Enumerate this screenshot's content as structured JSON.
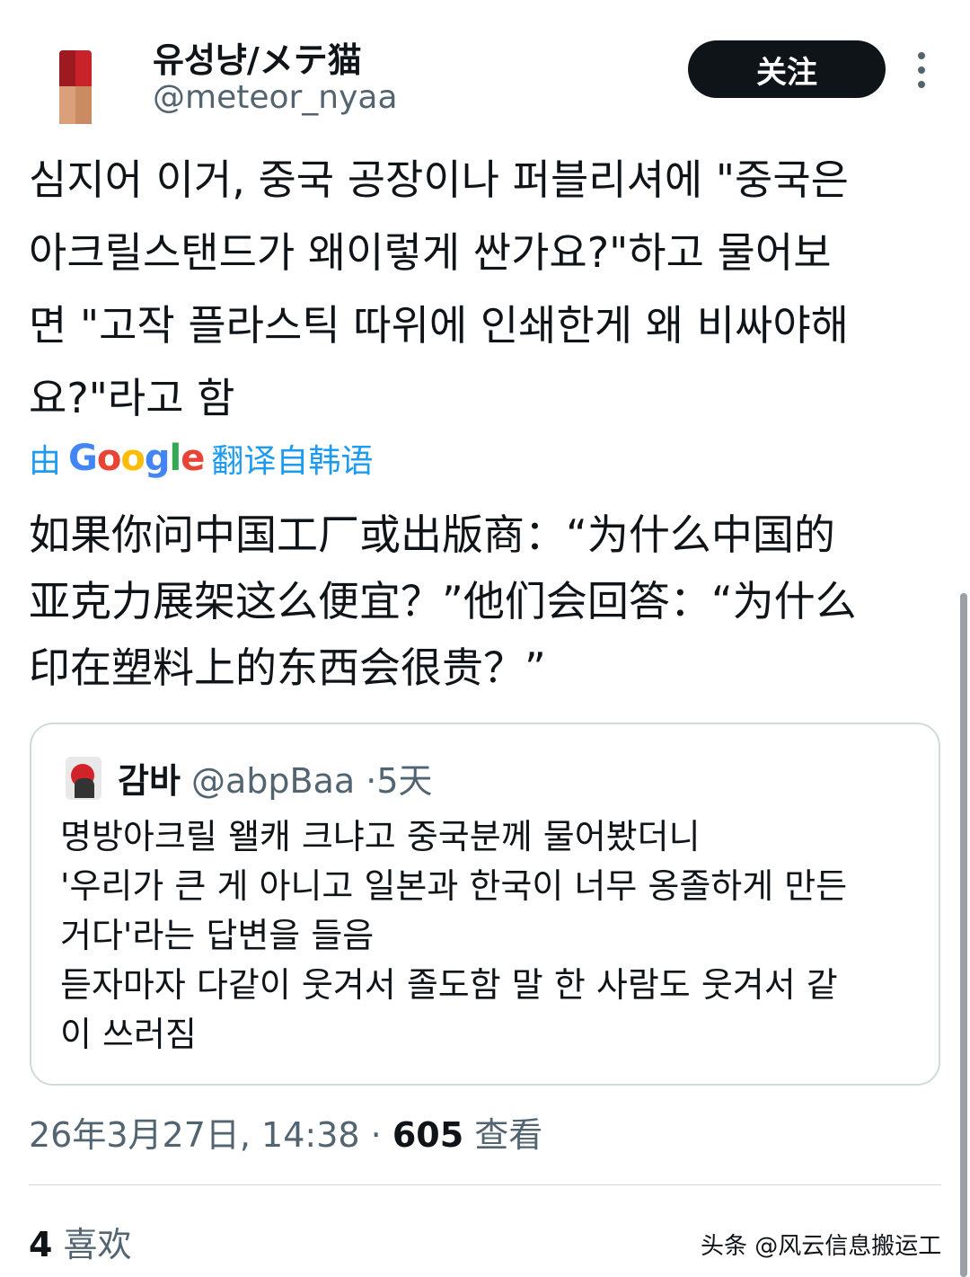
{
  "tweet": {
    "author_name": "유성냥/メテ猫",
    "author_handle": "@meteor_nyaa",
    "follow_label": "关注",
    "body_original": "심지어 이거, 중국 공장이나 퍼블리셔에 \"중국은\n아크릴스탠드가 왜이렇게 싼가요?\"하고 물어보\n면 \"고작 플라스틱 따위에 인쇄한게 왜 비싸야해\n요?\"라고 함",
    "translation_by": "由",
    "translation_brand": "Google",
    "translation_tail": "翻译自韩语",
    "body_translated": "如果你问中国工厂或出版商：“为什么中国的\n亚克力展架这么便宜？”他们会回答：“为什么\n印在塑料上的东西会很贵？”",
    "quoted": {
      "name": "감바",
      "handle": "@abpBaa",
      "separator": "·",
      "time": "5天",
      "text": "명방아크릴 왤캐 크냐고 중국분께 물어봤더니\n'우리가 큰 게 아니고 일본과 한국이 너무 옹졸하게 만든\n거다'라는 답변을 들음\n듣자마자 다같이 웃겨서 졸도함 말 한 사람도 웃겨서 같\n이 쓰러짐"
    },
    "timestamp": "26年3月27日, 14:38",
    "meta_separator": "·",
    "views_count": "605",
    "views_label": "查看",
    "likes_count": "4",
    "likes_label": "喜欢"
  },
  "watermark": "头条 @风云信息搬运工",
  "icons": {
    "more": "more-vertical-icon",
    "avatar": "avatar-image",
    "quoted_avatar": "avatar-image"
  },
  "colors": {
    "text_primary": "#0f1419",
    "text_secondary": "#536471",
    "link": "#1d9bf0",
    "border": "#cfd9de",
    "button_bg": "#0f1419"
  }
}
